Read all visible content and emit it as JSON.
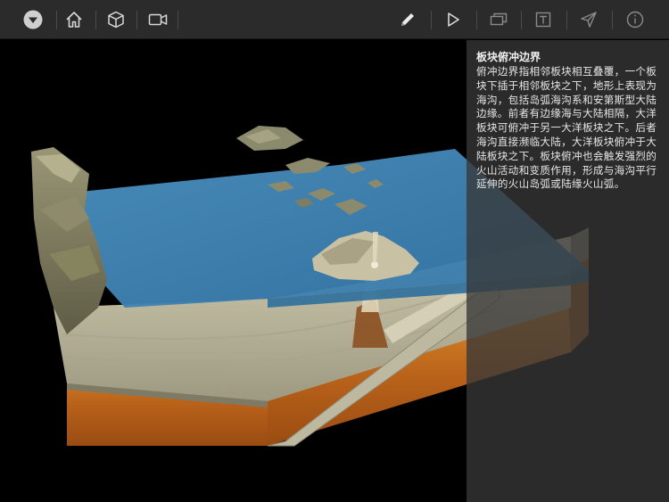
{
  "toolbar": {
    "left_buttons": [
      {
        "icon": "dropdown-circle-icon"
      },
      {
        "icon": "home-icon"
      },
      {
        "icon": "cube-icon"
      },
      {
        "icon": "video-camera-icon"
      }
    ],
    "right_buttons": [
      {
        "icon": "pencil-icon"
      },
      {
        "icon": "play-icon"
      },
      {
        "icon": "layers-icon"
      },
      {
        "icon": "text-box-icon"
      },
      {
        "icon": "send-icon"
      },
      {
        "icon": "info-icon"
      }
    ],
    "colors": {
      "background": "#2b2b2b",
      "icon_active": "#e8e8e8",
      "icon_dim": "#8a8a8a"
    }
  },
  "info": {
    "title": "板块俯冲边界",
    "body": "俯冲边界指相邻板块相互叠覆，一个板块下插于相邻板块之下，地形上表现为海沟，包括岛弧海沟系和安第斯型大陆边缘。前者有边缘海与大陆相隔，大洋板块可俯冲于另一大洋板块之下。后者海沟直接濒临大陆，大洋板块俯冲于大陆板块之下。板块俯冲也会触发强烈的火山活动和变质作用，形成与海沟平行延伸的火山岛弧或陆缘火山弧。"
  },
  "scene": {
    "colors": {
      "sea": "#3f86b8",
      "crust": "#b9b39a",
      "mantle": "#c6741e",
      "land": "#7d7a5c"
    }
  }
}
